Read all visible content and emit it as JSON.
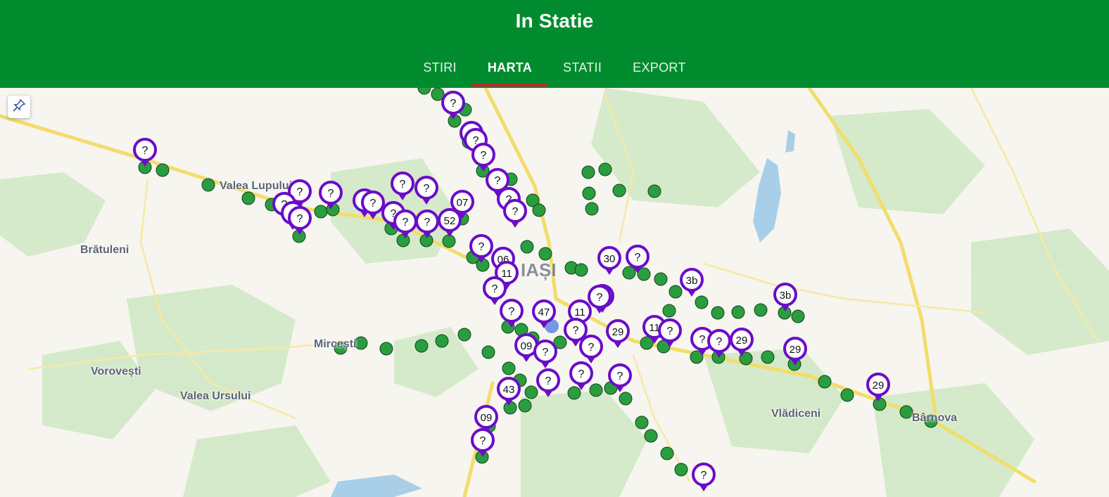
{
  "app": {
    "title": "In Statie"
  },
  "tabs": [
    {
      "label": "STIRI",
      "active": false
    },
    {
      "label": "HARTA",
      "active": true
    },
    {
      "label": "STATII",
      "active": false
    },
    {
      "label": "EXPORT",
      "active": false
    }
  ],
  "colors": {
    "appbar": "#008b2f",
    "tab_indicator": "#c62828",
    "marker_purple": "#6a0dc8",
    "station_green": "#2a9d3e"
  },
  "map": {
    "control_icon": "pushpin-icon",
    "places": [
      "Valea Lupului",
      "Brătuleni",
      "IAȘI",
      "Mircești",
      "Vorovești",
      "Valea Ursului",
      "Vlădiceni",
      "Bârnova"
    ],
    "bus_markers": [
      "?",
      "?",
      "?",
      "?",
      "?",
      "?",
      "?",
      "?",
      "?",
      "07",
      "52",
      "?",
      "?",
      "?",
      "?",
      "?",
      "?",
      "?",
      "?",
      "?",
      "?",
      "06",
      "11",
      "?",
      "?",
      "47",
      "11",
      "?",
      "29",
      "11",
      "?",
      "?",
      "?",
      "29",
      "?",
      "?",
      "3b",
      "3b",
      "29",
      "09",
      "?",
      "?",
      "?",
      "?",
      "?",
      "43",
      "09",
      "?",
      "?",
      "?",
      "29",
      "30",
      "?",
      "?"
    ]
  }
}
